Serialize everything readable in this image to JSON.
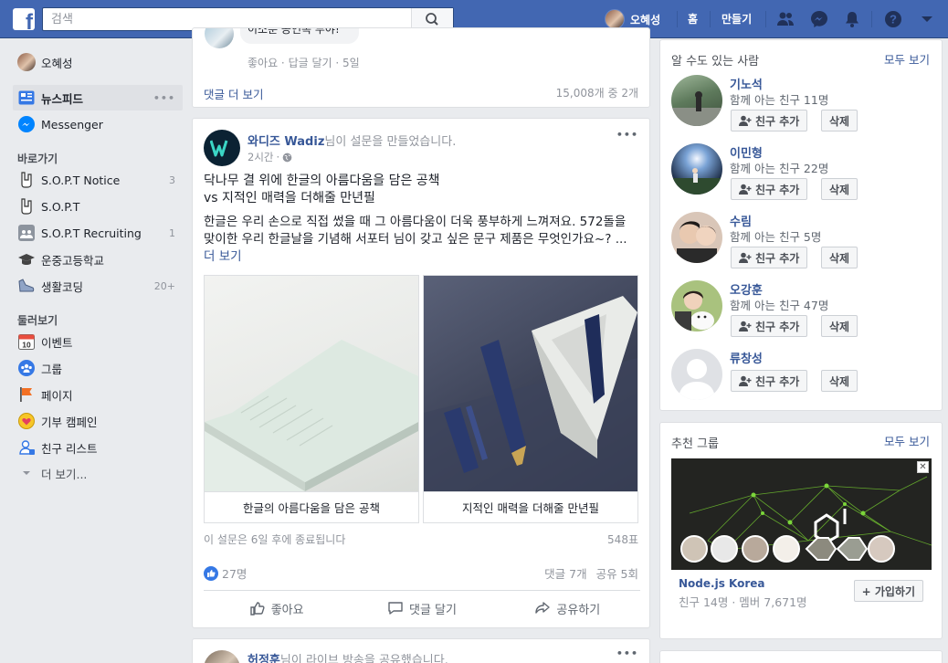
{
  "topbar": {
    "logo": "f",
    "search_placeholder": "검색",
    "user_name": "오혜성",
    "home": "홈",
    "create": "만들기"
  },
  "sidebar": {
    "user": "오혜성",
    "newsfeed": "뉴스피드",
    "messenger": "Messenger",
    "shortcuts_heading": "바로가기",
    "shortcuts": [
      {
        "label": "S.O.P.T Notice",
        "count": "3"
      },
      {
        "label": "S.O.P.T",
        "count": ""
      },
      {
        "label": "S.O.P.T Recruiting",
        "count": "1"
      },
      {
        "label": "운중고등학교",
        "count": ""
      },
      {
        "label": "생활코딩",
        "count": "20+"
      }
    ],
    "explore_heading": "둘러보기",
    "explore": [
      {
        "label": "이벤트"
      },
      {
        "label": "그룹"
      },
      {
        "label": "페이지"
      },
      {
        "label": "기부 캠페인"
      },
      {
        "label": "친구 리스트"
      }
    ],
    "more": "더 보기...",
    "calendar_day": "10"
  },
  "prev_post": {
    "comment_snippet": "이소룬 공연복 부야!",
    "actions": "좋아요 · 답글 달기 · 5일",
    "more_comments": "댓글 더 보기",
    "comment_count": "15,008개 중 2개"
  },
  "post": {
    "page_name": "와디즈 Wadiz",
    "action": "님이 설문을 만들었습니다.",
    "time": "2시간",
    "title_line1": "닥나무 결 위에 한글의 아름다움을 담은 공책",
    "title_line2": "vs 지적인 매력을 더해줄 만년필",
    "body": "한글은 우리 손으로 직접 썼을 때 그 아름다움이 더욱 풍부하게 느껴져요. 572돌을 맞이한 우리 한글날을 기념해 서포터 님이 갖고 싶은 문구 제품은 무엇인가요~? ...",
    "see_more": "더 보기",
    "option1": "한글의 아름다움을 담은 공책",
    "option2": "지적인 매력을 더해줄 만년필",
    "poll_ends": "이 설문은 6일 후에 종료됩니다",
    "votes": "548표",
    "likes": "27명",
    "comments": "댓글 7개",
    "shares": "공유 5회",
    "like_btn": "좋아요",
    "comment_btn": "댓글 달기",
    "share_btn": "공유하기"
  },
  "next_post": {
    "name": "허정훈",
    "action": "님이 라이브 방송을 공유했습니다."
  },
  "pymk": {
    "title": "알 수도 있는 사람",
    "see_all": "모두 보기",
    "add_label": "친구 추가",
    "remove_label": "삭제",
    "people": [
      {
        "name": "기노석",
        "mutual": "함께 아는 친구 11명"
      },
      {
        "name": "이민형",
        "mutual": "함께 아는 친구 22명"
      },
      {
        "name": "수림",
        "mutual": "함께 아는 친구 5명"
      },
      {
        "name": "오강훈",
        "mutual": "함께 아는 친구 47명"
      },
      {
        "name": "류창성",
        "mutual": ""
      }
    ]
  },
  "groups": {
    "title": "추천 그룹",
    "see_all": "모두 보기",
    "group_name": "Node.js Korea",
    "group_meta": "친구 14명 · 멤버 7,671명",
    "join": "+ 가입하기"
  }
}
